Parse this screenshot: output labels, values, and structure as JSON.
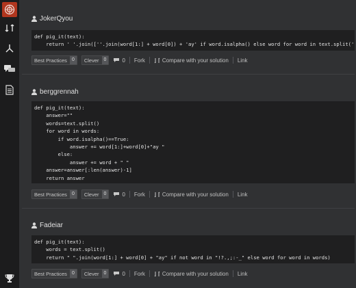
{
  "sidebar": {
    "icons": [
      "codewars-logo",
      "kata-icon",
      "fork-icon",
      "chat-icon",
      "docs-icon",
      "trophy-icon"
    ]
  },
  "solutions": [
    {
      "user": "JokerQyou",
      "best_practices": {
        "label": "Best Practices",
        "count": "0"
      },
      "clever": {
        "label": "Clever",
        "count": "0"
      },
      "comments": "0",
      "fork": "Fork",
      "compare": "Compare with your solution",
      "link": "Link"
    },
    {
      "user": "berggrennah",
      "best_practices": {
        "label": "Best Practices",
        "count": "0"
      },
      "clever": {
        "label": "Clever",
        "count": "0"
      },
      "comments": "0",
      "fork": "Fork",
      "compare": "Compare with your solution",
      "link": "Link"
    },
    {
      "user": "Fadeiar",
      "best_practices": {
        "label": "Best Practices",
        "count": "0"
      },
      "clever": {
        "label": "Clever",
        "count": "0"
      },
      "comments": "0",
      "fork": "Fork",
      "compare": "Compare with your solution",
      "link": "Link"
    }
  ],
  "code": {
    "s0": [
      "def pig_it(text):",
      "    return ' '.join([''.join(word[1:] + word[0]) + 'ay' if word.isalpha() else word for word in text.split(' ')])"
    ],
    "s1": [
      "def pig_it(text):",
      "    answer=\"\"",
      "    words=text.split()",
      "    for word in words:",
      "        if word.isalpha()==True:",
      "            answer += word[1:]+word[0]+\"ay \"",
      "        else:",
      "            answer += word + \" \"",
      "    answer=answer[:len(answer)-1]",
      "    return answer"
    ],
    "s2": [
      "def pig_it(text):",
      "    words = text.split()",
      "    return \" \".join(word[1:] + word[0] + \"ay\" if not word in \"!?.,;:-_\" else word for word in words)"
    ]
  }
}
